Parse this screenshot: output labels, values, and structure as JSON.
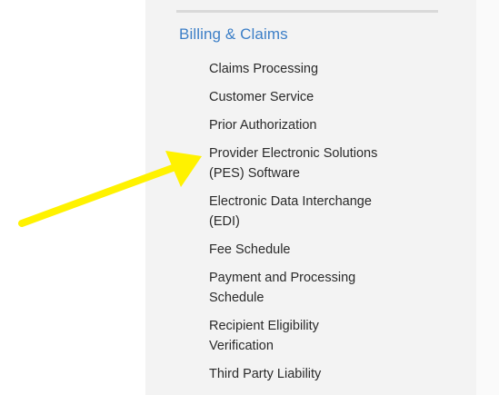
{
  "section": {
    "heading": "Billing & Claims",
    "heading_color": "#3c7fc7"
  },
  "nav": {
    "items": [
      {
        "label": "Claims Processing"
      },
      {
        "label": "Customer Service"
      },
      {
        "label": "Prior Authorization"
      },
      {
        "label": "Provider Electronic Solutions\n(PES) Software"
      },
      {
        "label": "Electronic Data Interchange\n(EDI)"
      },
      {
        "label": "Fee Schedule"
      },
      {
        "label": "Payment and Processing\nSchedule"
      },
      {
        "label": "Recipient Eligibility\nVerification"
      },
      {
        "label": "Third Party Liability"
      }
    ]
  },
  "annotation": {
    "arrow_icon": "yellow-arrow-icon",
    "arrow_color": "#fff200",
    "points_to": "Provider Electronic Solutions (PES) Software"
  }
}
